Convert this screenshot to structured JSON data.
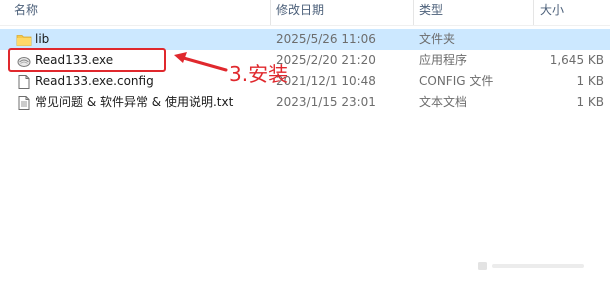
{
  "columns": {
    "name": "名称",
    "modified": "修改日期",
    "type": "类型",
    "size": "大小"
  },
  "files": [
    {
      "name": "lib",
      "modified": "2025/5/26 11:06",
      "type": "文件夹",
      "size": "",
      "icon": "folder-icon"
    },
    {
      "name": "Read133.exe",
      "modified": "2025/2/20 21:20",
      "type": "应用程序",
      "size": "1,645 KB",
      "icon": "app-icon"
    },
    {
      "name": "Read133.exe.config",
      "modified": "2021/12/1 10:48",
      "type": "CONFIG 文件",
      "size": "1 KB",
      "icon": "file-icon"
    },
    {
      "name": "常见问题 & 软件异常 & 使用说明.txt",
      "modified": "2023/1/15 23:01",
      "type": "文本文档",
      "size": "1 KB",
      "icon": "text-file-icon"
    }
  ],
  "annotation": {
    "label": "3.安装",
    "color": "#e0282d"
  },
  "colors": {
    "folder": "#f5c84c",
    "header_text": "#4c607a",
    "meta_text": "#6d6d6d"
  }
}
